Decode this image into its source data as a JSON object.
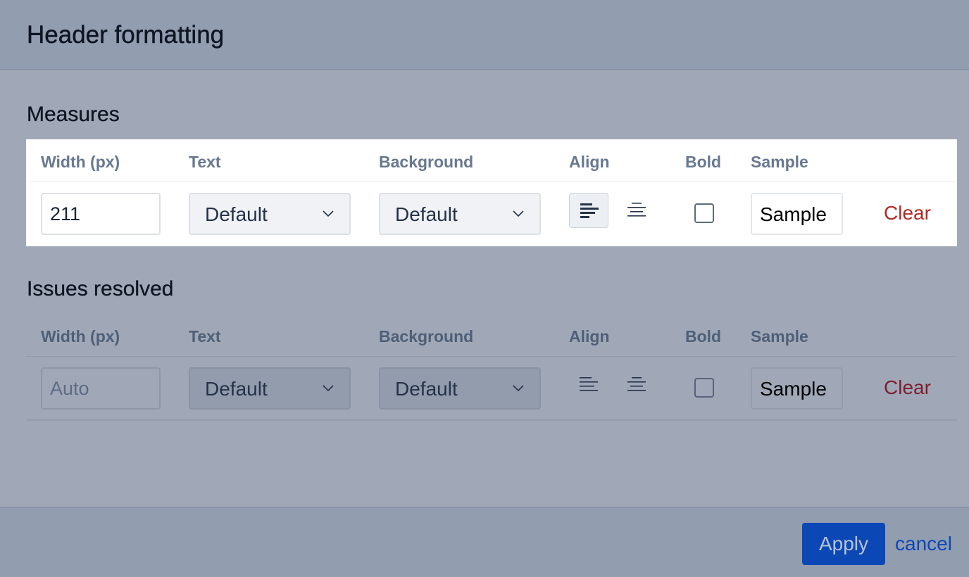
{
  "dialog": {
    "title": "Header formatting"
  },
  "columns": {
    "width": "Width (px)",
    "text": "Text",
    "background": "Background",
    "align": "Align",
    "bold": "Bold",
    "sample": "Sample"
  },
  "sections": [
    {
      "title": "Measures",
      "width_value": "211",
      "width_placeholder": "Auto",
      "text_color": "Default",
      "background_color": "Default",
      "align": "left",
      "bold": false,
      "sample_text": "Sample",
      "clear_label": "Clear"
    },
    {
      "title": "Issues resolved",
      "width_value": "",
      "width_placeholder": "Auto",
      "text_color": "Default",
      "background_color": "Default",
      "align": "none",
      "bold": false,
      "sample_text": "Sample",
      "clear_label": "Clear"
    }
  ],
  "footer": {
    "apply_label": "Apply",
    "cancel_label": "cancel"
  },
  "icons": {
    "align_left": "align-left-icon",
    "align_center": "align-center-icon",
    "dropdown": "chevron-down-icon"
  },
  "colors": {
    "primary": "#0b48b6",
    "danger": "#b12a24"
  }
}
